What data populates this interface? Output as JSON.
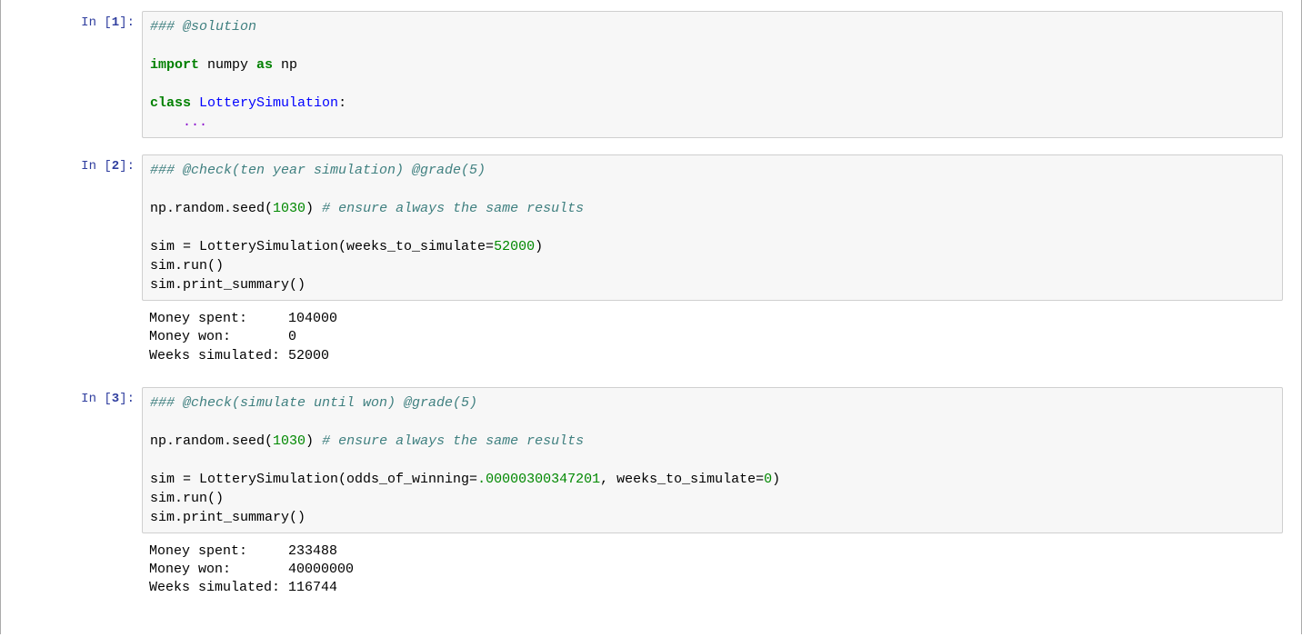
{
  "cells": [
    {
      "prompt_prefix": "In [",
      "prompt_num": "1",
      "prompt_suffix": "]:",
      "code": {
        "l0_comment": "### @solution",
        "l1_blank": "",
        "l2_import": "import",
        "l2_numpy": " numpy ",
        "l2_as": "as",
        "l2_np": " np",
        "l3_blank": "",
        "l4_class": "class",
        "l4_space": " ",
        "l4_name": "LotterySimulation",
        "l4_colon": ":",
        "l5_indent": "    ",
        "l5_dots": "..."
      },
      "output": null
    },
    {
      "prompt_prefix": "In [",
      "prompt_num": "2",
      "prompt_suffix": "]:",
      "code": {
        "l0_comment": "### @check(ten year simulation) @grade(5)",
        "l1_blank": "",
        "l2_a": "np.random.seed(",
        "l2_num": "1030",
        "l2_b": ") ",
        "l2_c": "# ensure always the same results",
        "l3_blank": "",
        "l4_a": "sim = LotterySimulation(weeks_to_simulate=",
        "l4_num": "52000",
        "l4_b": ")",
        "l5": "sim.run()",
        "l6": "sim.print_summary()"
      },
      "output": "Money spent:     104000\nMoney won:       0\nWeeks simulated: 52000"
    },
    {
      "prompt_prefix": "In [",
      "prompt_num": "3",
      "prompt_suffix": "]:",
      "code": {
        "l0_comment": "### @check(simulate until won) @grade(5)",
        "l1_blank": "",
        "l2_a": "np.random.seed(",
        "l2_num": "1030",
        "l2_b": ") ",
        "l2_c": "# ensure always the same results",
        "l3_blank": "",
        "l4_a": "sim = LotterySimulation(odds_of_winning=",
        "l4_num1": ".00000300347201",
        "l4_b": ", weeks_to_simulate=",
        "l4_num2": "0",
        "l4_c": ")",
        "l5": "sim.run()",
        "l6": "sim.print_summary()"
      },
      "output": "Money spent:     233488\nMoney won:       40000000\nWeeks simulated: 116744"
    }
  ]
}
